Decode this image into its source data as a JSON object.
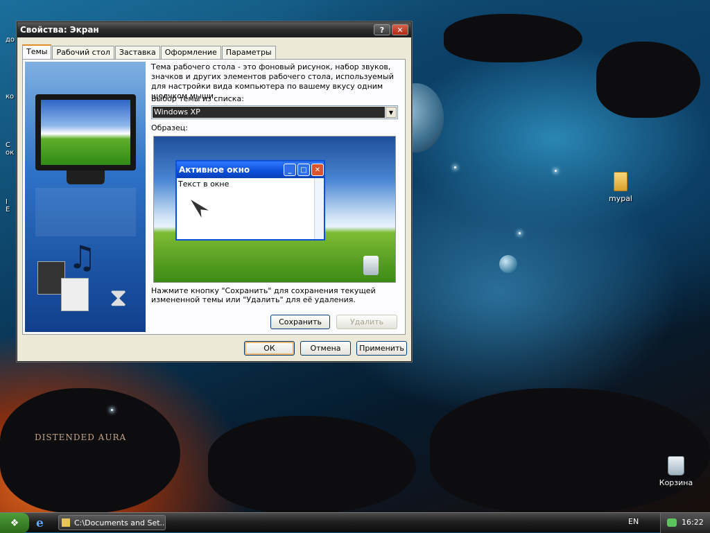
{
  "dialog": {
    "title": "Свойства: Экран",
    "help_glyph": "?",
    "close_glyph": "✕",
    "tabs": [
      "Темы",
      "Рабочий стол",
      "Заставка",
      "Оформление",
      "Параметры"
    ],
    "description": "Тема рабочего стола - это фоновый рисунок, набор звуков, значков и других элементов рабочего стола, используемый для настройки вида компьютера по вашему вкусу одним щелчком мыши.",
    "theme_label": "Выбор темы из списка:",
    "theme_value": "Windows XP",
    "sample_label": "Образец:",
    "hint": "Нажмите кнопку \"Сохранить\" для сохранения текущей измененной темы или \"Удалить\" для её удаления.",
    "save_button": "Сохранить",
    "delete_button": "Удалить",
    "ok_button": "ОК",
    "cancel_button": "Отмена",
    "apply_button": "Применить"
  },
  "preview": {
    "window_title": "Активное окно",
    "window_text": "Текст в окне",
    "min_glyph": "_",
    "max_glyph": "□",
    "close_glyph": "✕"
  },
  "desktop": {
    "folder_icon_label": "mypal",
    "recycle_bin_label": "Корзина",
    "wallpaper_brand": "DISTENDED AURA",
    "edge_labels": [
      "до",
      "ко",
      "С\nок",
      "I\nE"
    ]
  },
  "taskbar": {
    "start_glyph": "❖",
    "ie_glyph": "e",
    "task_item": "C:\\Documents and Set...",
    "language": "EN",
    "clock": "16:22"
  }
}
